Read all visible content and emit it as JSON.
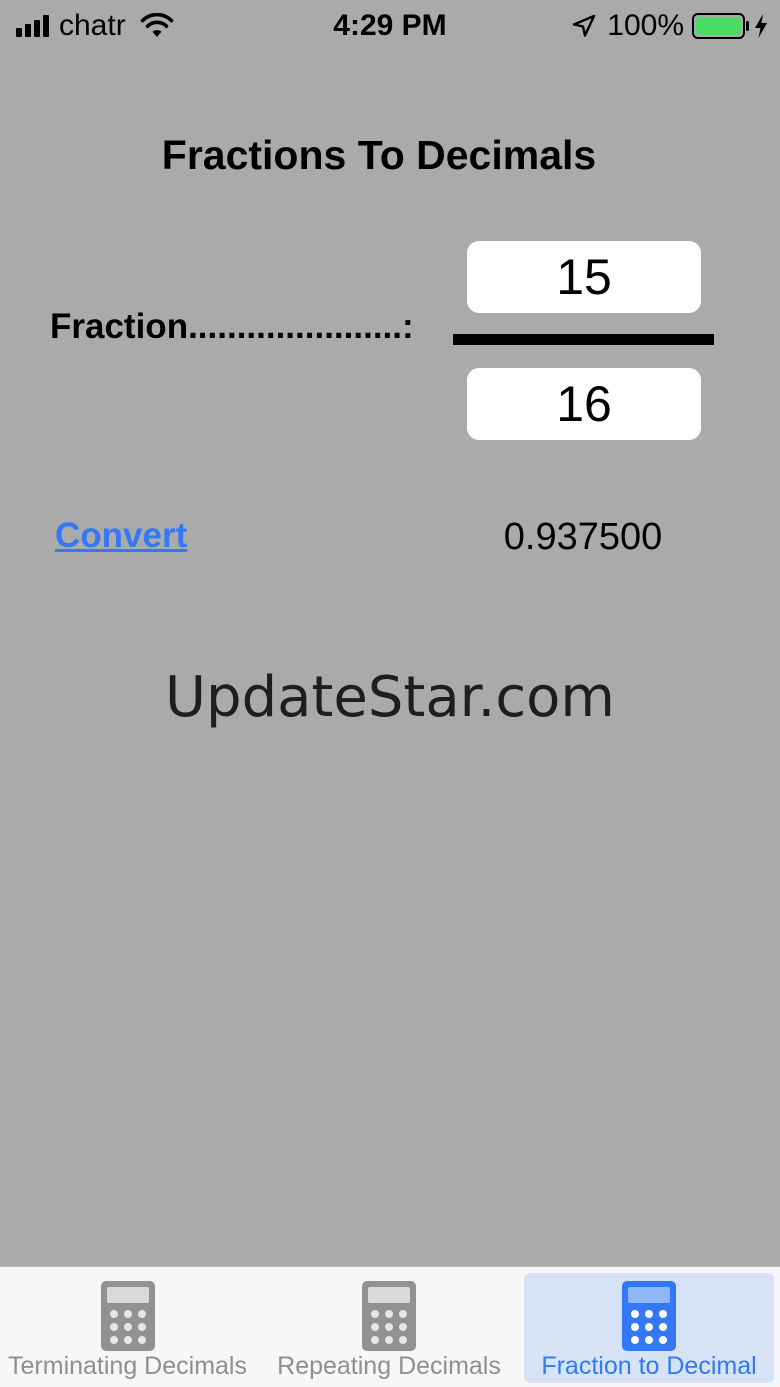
{
  "status_bar": {
    "carrier": "chatr",
    "time": "4:29 PM",
    "battery_percent": "100%",
    "battery_level": 1.0,
    "signal_bars": 4,
    "icons": [
      "signal-bars-icon",
      "wifi-icon",
      "location-arrow-icon",
      "battery-icon",
      "charging-bolt-icon"
    ]
  },
  "page": {
    "title": "Fractions To Decimals",
    "fraction_label": "Fraction......................:",
    "numerator": "15",
    "denominator": "16",
    "convert_label": "Convert",
    "result": "0.937500",
    "watermark": "UpdateStar.com"
  },
  "colors": {
    "background": "#aaaaaa",
    "accent": "#3478f6",
    "tab_inactive": "#8e8e93",
    "tab_active_bg": "#d5e3f5"
  },
  "tabs": [
    {
      "label": "Terminating Decimals",
      "icon": "calculator-icon",
      "active": false
    },
    {
      "label": "Repeating Decimals",
      "icon": "calculator-icon",
      "active": false
    },
    {
      "label": "Fraction to Decimal",
      "icon": "calculator-icon",
      "active": true
    }
  ]
}
